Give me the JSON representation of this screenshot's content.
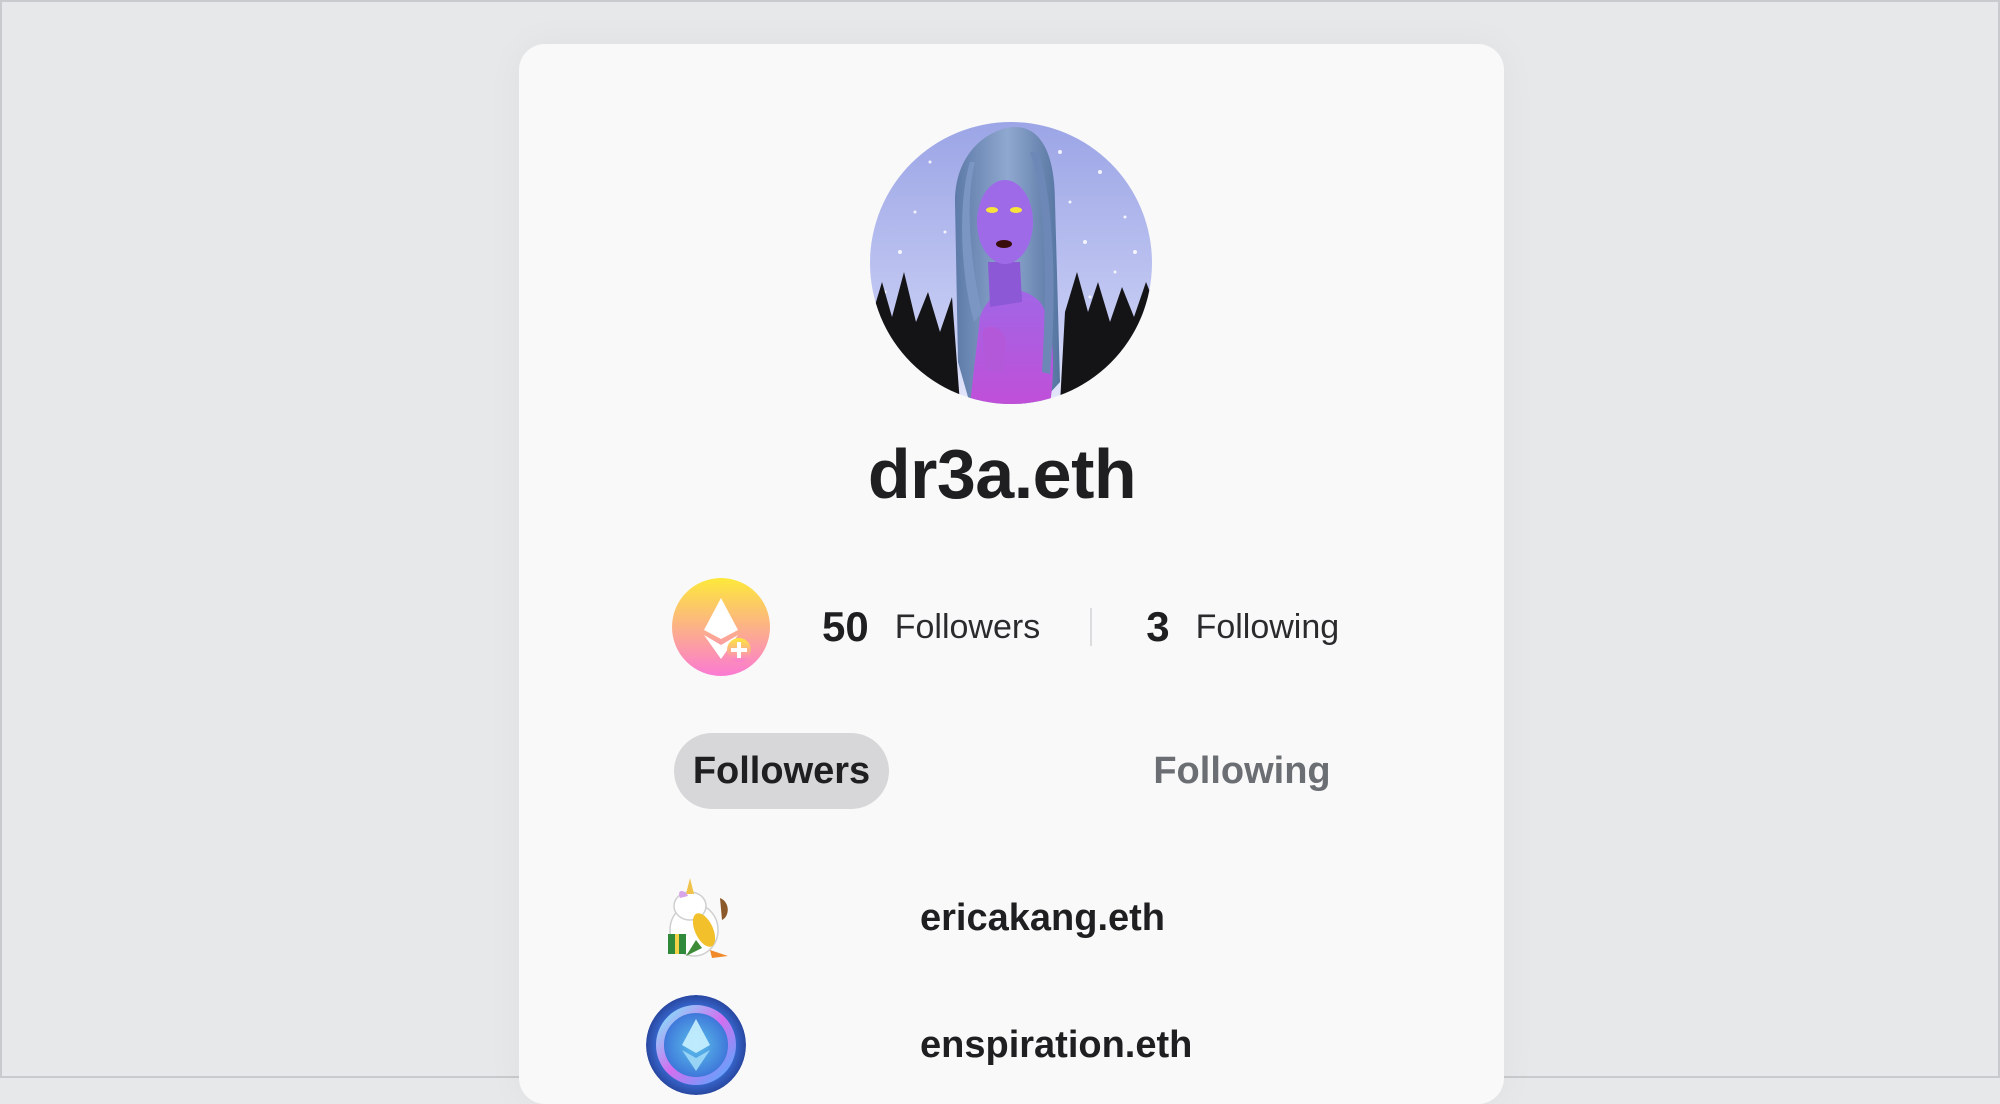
{
  "profile": {
    "name": "dr3a.eth"
  },
  "stats": {
    "followers_count": "50",
    "followers_label": "Followers",
    "following_count": "3",
    "following_label": "Following"
  },
  "tabs": [
    {
      "label": "Followers",
      "active": true
    },
    {
      "label": "Following",
      "active": false
    }
  ],
  "followers": [
    {
      "name": "ericakang.eth",
      "avatar_icon": "unicorn-avatar-icon"
    },
    {
      "name": "enspiration.eth",
      "avatar_icon": "ens-logo-avatar-icon"
    }
  ],
  "colors": {
    "background": "#e7e8ea",
    "card": "#f9f9f9",
    "text": "#1f1f22",
    "active_tab": "#d7d7da",
    "inactive_tab_text": "#6b6e73",
    "badge_gradient_top": "#fde93a",
    "badge_gradient_bottom": "#fb7ad3"
  }
}
